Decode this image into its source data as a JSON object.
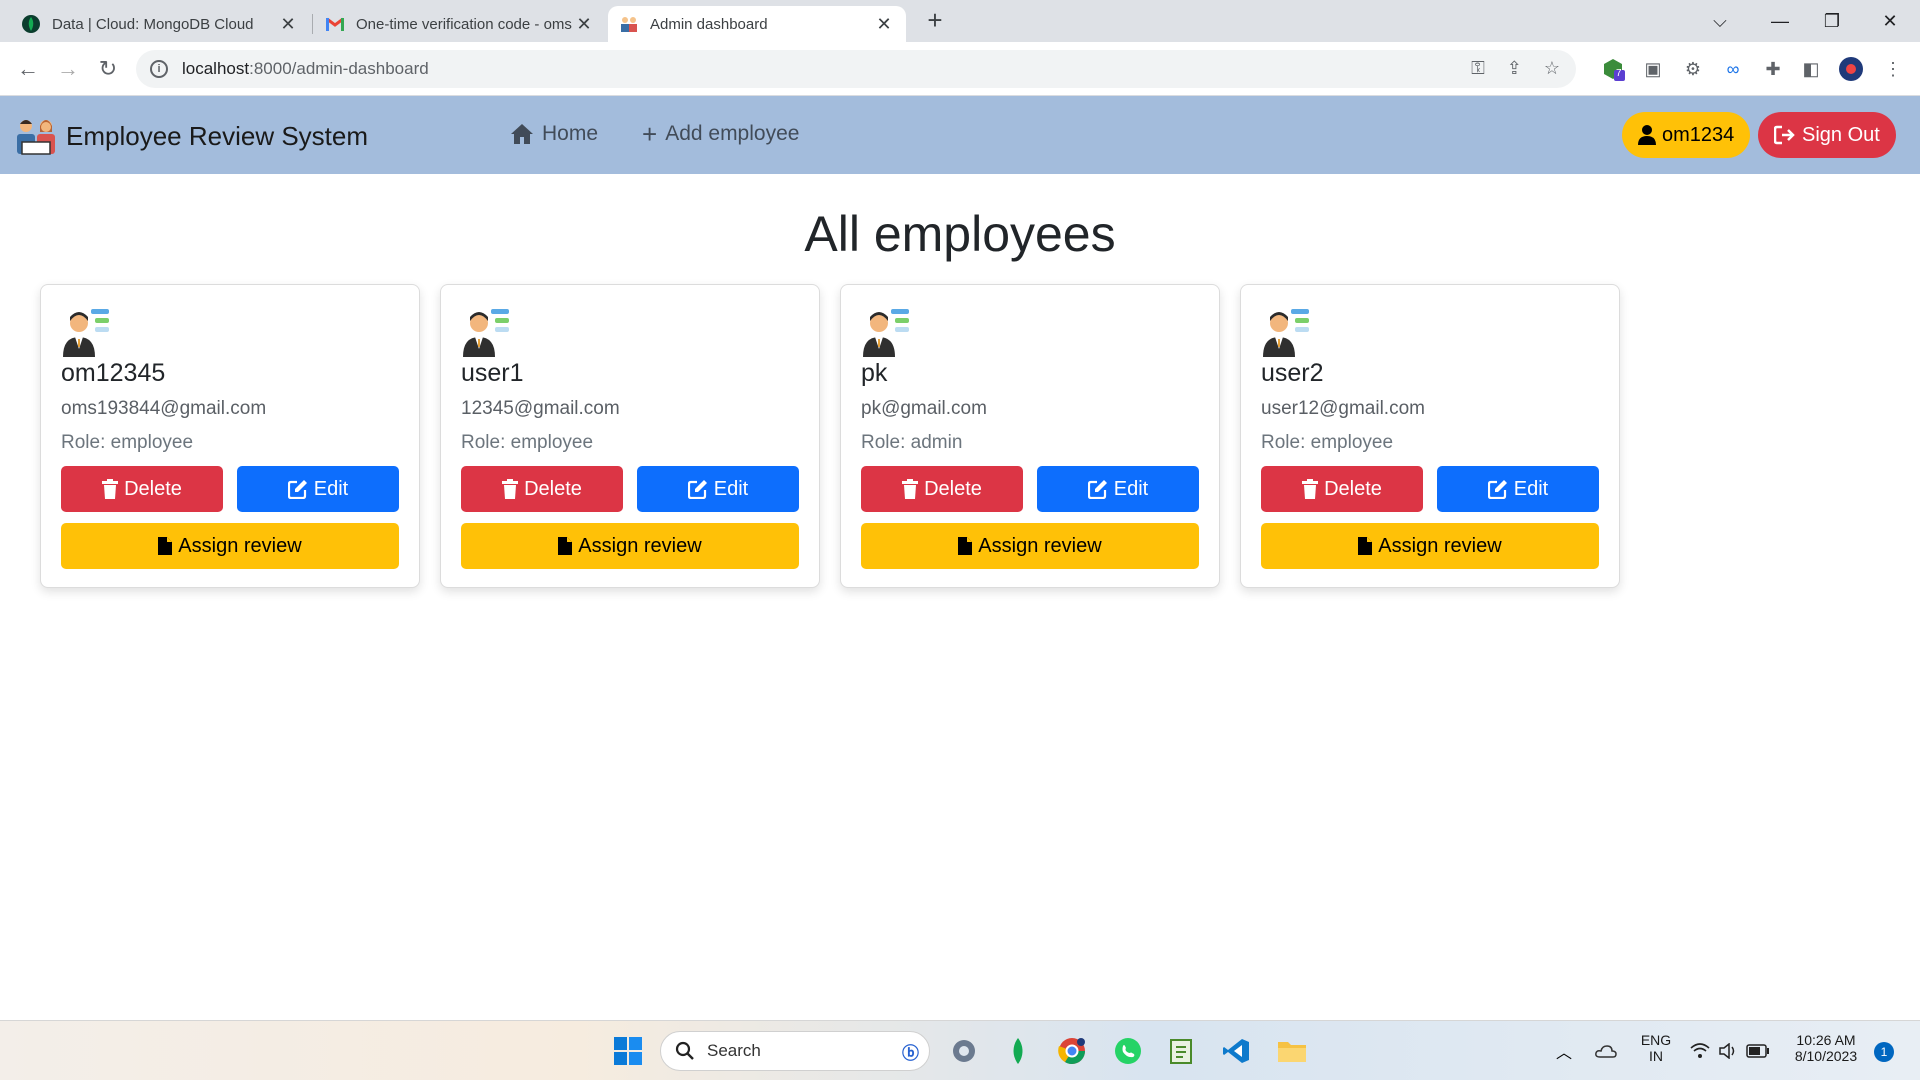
{
  "browser": {
    "tabs": [
      {
        "title": "Data | Cloud: MongoDB Cloud",
        "favicon": "mongodb-leaf-icon"
      },
      {
        "title": "One-time verification code - oms",
        "favicon": "gmail-icon"
      },
      {
        "title": "Admin dashboard",
        "favicon": "employee-icon",
        "active": true
      }
    ],
    "url_host": "localhost",
    "url_path": ":8000/admin-dashboard",
    "extension_badge": "7"
  },
  "app": {
    "brand": "Employee Review System",
    "nav": {
      "home": "Home",
      "add_employee": "Add employee"
    },
    "user": "om1234",
    "sign_out": "Sign Out"
  },
  "page": {
    "title": "All employees"
  },
  "employees": [
    {
      "name": "om12345",
      "email": "oms193844@gmail.com",
      "role": "Role: employee"
    },
    {
      "name": "user1",
      "email": "12345@gmail.com",
      "role": "Role: employee"
    },
    {
      "name": "pk",
      "email": "pk@gmail.com",
      "role": "Role: admin"
    },
    {
      "name": "user2",
      "email": "user12@gmail.com",
      "role": "Role: employee"
    }
  ],
  "card_actions": {
    "delete": "Delete",
    "edit": "Edit",
    "assign": "Assign review"
  },
  "taskbar": {
    "search": "Search",
    "lang_top": "ENG",
    "lang_bottom": "IN",
    "time": "10:26 AM",
    "date": "8/10/2023",
    "notifications": "1"
  },
  "colors": {
    "navbar": "#a3bcdc",
    "danger": "#dc3545",
    "primary": "#0d6efd",
    "warning": "#ffc107"
  }
}
